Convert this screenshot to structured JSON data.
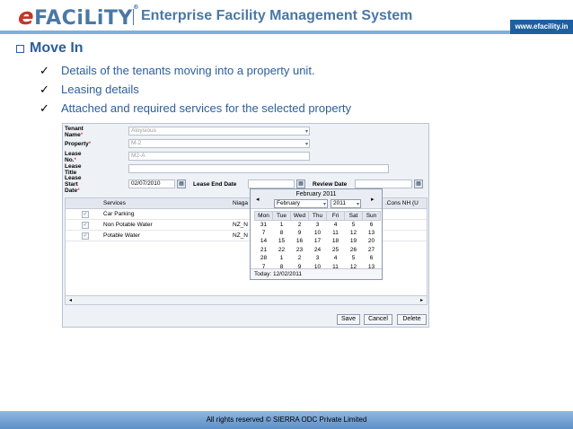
{
  "header": {
    "logo_e": "e",
    "logo_text": "FACiLiTY",
    "logo_reg": "®",
    "title": "Enterprise Facility Management System",
    "url": "www.efacility.in"
  },
  "section": {
    "title": "Move In",
    "bullets": [
      "Details of the tenants moving into a property unit.",
      "Leasing details",
      "Attached and required services for the selected property"
    ]
  },
  "form": {
    "tenant_name": {
      "label": "Tenant Name",
      "value": "Aloysious"
    },
    "property": {
      "label": "Property",
      "value": "M-2"
    },
    "lease_no": {
      "label": "Lease No.",
      "value": "M2-A"
    },
    "lease_title": {
      "label": "Lease Title",
      "value": ""
    },
    "lease_start_date": {
      "label": "Lease Start Date",
      "value": "02/07/2010"
    },
    "lease_end_date": {
      "label": "Lease End Date",
      "value": ""
    },
    "review_date": {
      "label": "Review Date",
      "value": ""
    },
    "required_mark": "*"
  },
  "grid": {
    "columns": [
      "Services",
      "Niaga",
      ".Cons NH (U"
    ],
    "rows": [
      {
        "service": "Car Parking",
        "code": ""
      },
      {
        "service": "Non Potable Water",
        "code": "NZ_N"
      },
      {
        "service": "Potable Water",
        "code": "NZ_N"
      }
    ]
  },
  "buttons": {
    "save": "Save",
    "cancel": "Cancel",
    "delete": "Delete"
  },
  "calendar": {
    "title": "February 2011",
    "month": "February",
    "year": "2011",
    "weekdays": [
      "Mon",
      "Tue",
      "Wed",
      "Thu",
      "Fri",
      "Sat",
      "Sun"
    ],
    "weeks": [
      [
        "31",
        "1",
        "2",
        "3",
        "4",
        "5",
        "6"
      ],
      [
        "7",
        "8",
        "9",
        "10",
        "11",
        "12",
        "13"
      ],
      [
        "14",
        "15",
        "16",
        "17",
        "18",
        "19",
        "20"
      ],
      [
        "21",
        "22",
        "23",
        "24",
        "25",
        "26",
        "27"
      ],
      [
        "28",
        "1",
        "2",
        "3",
        "4",
        "5",
        "6"
      ],
      [
        "7",
        "8",
        "9",
        "10",
        "11",
        "12",
        "13"
      ]
    ],
    "today": "Today: 12/02/2011"
  },
  "footer": {
    "text": "All rights reserved © SIERRA ODC Private Limited"
  }
}
